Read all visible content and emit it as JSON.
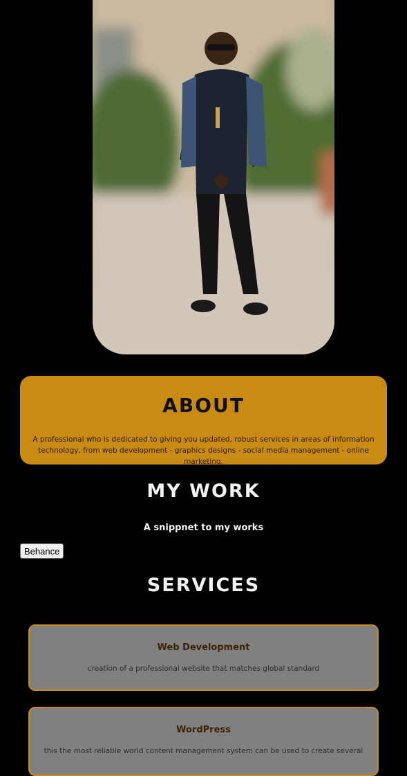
{
  "profile": {
    "image_alt": "Portrait photo of a man in a dark outfit and sunglasses standing outdoors"
  },
  "about": {
    "title": "ABOUT",
    "text": "A professional who is dedicated to giving you updated, robust services in areas of information technology, from web development - graphics designs - social media management - online marketing."
  },
  "work": {
    "title": "MY WORK",
    "subtitle": "A snippnet to my works",
    "behance_label": "Behance"
  },
  "services": {
    "title": "SERVICES",
    "items": [
      {
        "title": "Web Development",
        "text": "creation of a professional website that matches global standard"
      },
      {
        "title": "WordPress",
        "text": "this the most reliable world content management system can be used to create several"
      }
    ]
  },
  "colors": {
    "accent": "#c98b13",
    "background": "#000000",
    "card": "#808080"
  }
}
